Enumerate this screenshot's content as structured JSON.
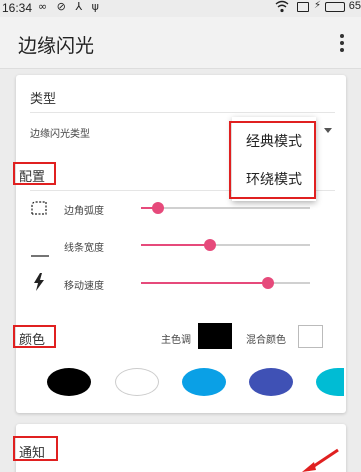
{
  "status_bar": {
    "time": "16:34",
    "left_icons": "∞ ⊘ ⅄ ψ",
    "battery_level": 0.65,
    "battery_text": "65",
    "battery_color": "#25a244"
  },
  "app_bar": {
    "title": "边缘闪光",
    "menu_icon": "more-vert-icon"
  },
  "type_section": {
    "title": "类型",
    "type_label": "边缘闪光类型"
  },
  "dropdown_menu": {
    "items": [
      "经典模式",
      "环绕模式"
    ]
  },
  "config_section": {
    "title": "配置",
    "settings": [
      {
        "label": "边角弧度",
        "icon": "corner-radius-icon",
        "value": 0.1
      },
      {
        "label": "线条宽度",
        "icon": "line-width-icon",
        "value": 0.41
      },
      {
        "label": "移动速度",
        "icon": "bolt-icon",
        "value": 0.75
      }
    ],
    "accent_color": "#e64a7b"
  },
  "color_section": {
    "title": "颜色",
    "primary_label": "主色调",
    "primary_color": "#000000",
    "mixed_label": "混合颜色",
    "mixed_color": "#ffffff",
    "palette": [
      "#000000",
      "#ffffff",
      "#0aa0e6",
      "#3f51b5",
      "#00bcd4"
    ]
  },
  "notification_section": {
    "title": "通知"
  },
  "annotation_color": "#e02020"
}
